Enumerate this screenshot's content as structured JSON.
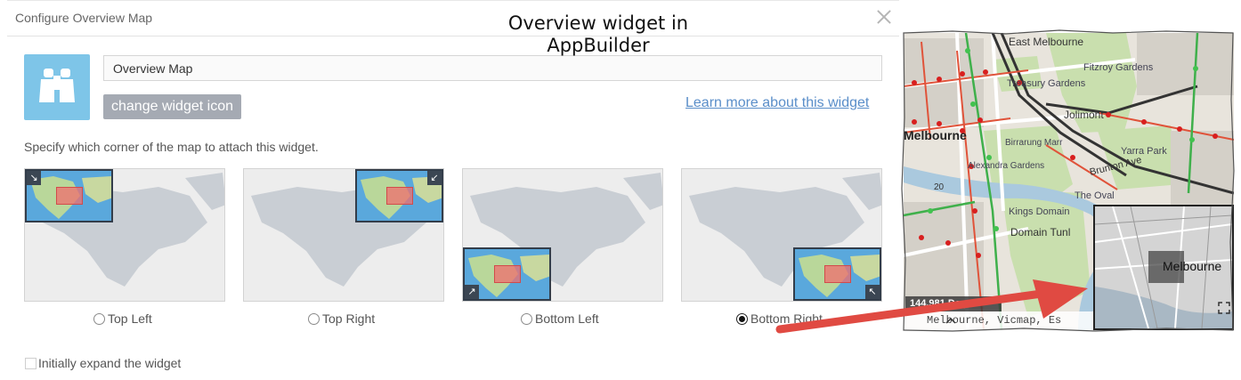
{
  "dialog": {
    "title": "Configure Overview Map",
    "widget_name_value": "Overview Map",
    "change_icon_label": "change widget icon",
    "learn_more_label": "Learn more about this widget",
    "instruction": "Specify which corner of the map to attach this widget.",
    "corners": [
      {
        "label": "Top Left",
        "selected": false
      },
      {
        "label": "Top Right",
        "selected": false
      },
      {
        "label": "Bottom Left",
        "selected": false
      },
      {
        "label": "Bottom Right",
        "selected": true
      }
    ],
    "expand_label": "Initially expand the widget",
    "expand_checked": false
  },
  "annotation": {
    "title_line1": "Overview widget in",
    "title_line2": "AppBuilder"
  },
  "map": {
    "labels": {
      "east_melbourne": "East Melbourne",
      "fitzroy_gardens": "Fitzroy Gardens",
      "treasury_gardens": "Treasury Gardens",
      "jolimont": "Jolimont",
      "melbourne": "Melbourne",
      "birrarung_marr": "Birrarung Marr",
      "yarra_park": "Yarra Park",
      "alexandra_gardens": "Alexandra Gardens",
      "brunton_ave": "Brunton Ave",
      "kings_domain": "Kings Domain",
      "domain_tunl": "Domain Tunl",
      "the_oval": "The Oval",
      "route_20": "20"
    },
    "overview_label": "Melbourne",
    "scale_text": "144,981 Degr",
    "attribution": "Melbourne, Vicmap, Es"
  },
  "colors": {
    "accent_blue": "#7ec5e8",
    "link": "#5a8ec9",
    "button_gray": "#a5aab3",
    "annotation_arrow": "#e04a42"
  }
}
